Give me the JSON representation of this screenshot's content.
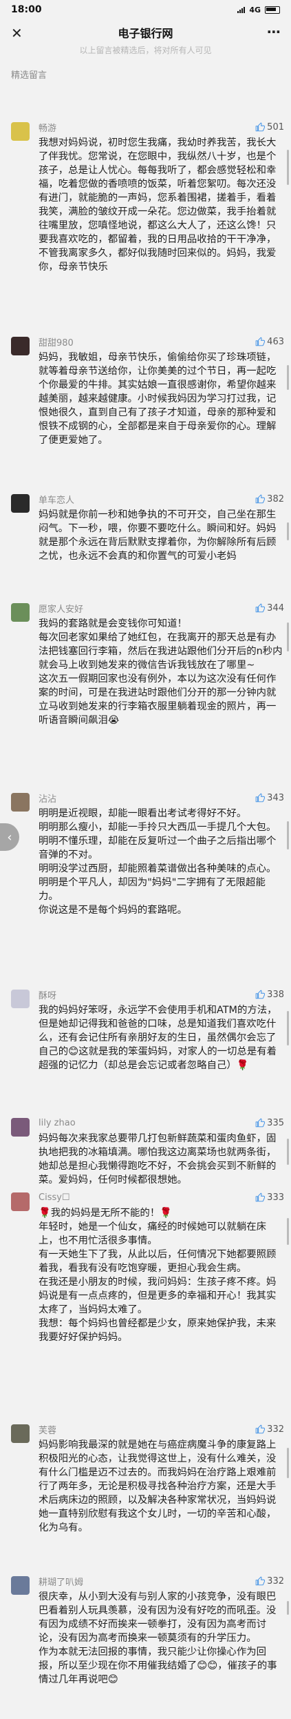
{
  "status": {
    "time": "18:00",
    "network": "4G"
  },
  "nav": {
    "title": "电子银行网",
    "close_icon": "close-icon",
    "more_icon": "more-icon"
  },
  "notice": "以上留言被精选后，将对所有人可见",
  "section_title": "精选留言",
  "comments": [
    {
      "name": "畅游",
      "likes": "501",
      "avatar_color": "#d9c24a",
      "text": "我想对妈妈说，初时您生我痛，我幼时养我苦，我长大了伴我忧。您常说，在您眼中，我纵然八十岁，也是个孩子，总是让人忧心。每每我听了，都会感觉轻松和幸福，吃着您做的香喷喷的饭菜，听着您絮叨。每次还没有进门，就能脆的一声妈，您系着围裙，搓着手，看着我笑，满脸的皱纹开成一朵花。您边做菜，我手抬着就往嘴里放，您嗔怪地说，都这么大人了，还这么馋！只要我喜欢吃的，都留着，我的日用品收拾的干干净净，不管我离家多久，都好似我随时回来似的。妈妈，我爱你，母亲节快乐"
    },
    {
      "name": "甜甜980",
      "likes": "463",
      "avatar_color": "#3a2a2a",
      "text": "妈妈，我敏姐，母亲节快乐，偷偷给你买了珍珠项链，就等着母亲节送给你，让你美美的过个节日，再一起吃个你最爱的牛排。其实姑娘一直很感谢你，希望你越来越美丽，越来越健康。小时候我妈因为学习打过我，记恨她很久，直到自己有了孩子才知道，母亲的那种爱和恨铁不成钢的心，全部都是来自于母亲爱你的心。理解了便更爱她了。"
    },
    {
      "name": "单车恋人",
      "likes": "382",
      "avatar_color": "#2a2a2a",
      "text": "妈妈就是你前一秒和她争执的不可开交，自己坐在那生闷气。下一秒，喂，你要不要吃什么。瞬间和好。妈妈就是那个永远在背后默默支撑着你，为你解除所有后顾之忧，也永远不会真的和你置气的可爱小老妈"
    },
    {
      "name": "愿家人安好",
      "likes": "344",
      "avatar_color": "#6b8f5a",
      "text": "我妈的套路就是会变钱你可知道！\n每次回老家如果给了她红包，在我离开的那天总是有办法把钱塞回行李箱，然后在我进站跟他们分开后的n秒内就会马上收到她发来的微信告诉我钱放在了哪里~\n这次五一假期回家也没有例外，本以为这次没有任何作案的时间，可是在我进站时跟他们分开的那一分钟内就立马收到她发来的行李箱衣服里躺着现金的照片，再一听语音瞬间飙泪😭"
    },
    {
      "name": "沾沾",
      "likes": "343",
      "avatar_color": "#8a7560",
      "text": "明明是近视眼，却能一眼看出考试考得好不好。\n明明那么瘦小，却能一手拎只大西瓜一手提几个大包。\n明明不懂乐理，却能在反复听过一个曲子之后指出哪个音弹的不对。\n明明没学过西厨，却能照着菜谱做出各种美味的点心。\n明明是个平凡人，却因为\"妈妈\"二字拥有了无限超能力。\n你说这是不是每个妈妈的套路呢。"
    },
    {
      "name": "酥呀",
      "likes": "338",
      "avatar_color": "#c8c8d8",
      "text": "我的妈妈好笨呀，永远学不会使用手机和ATM的方法，但是她却记得我和爸爸的口味，总是知道我们喜欢吃什么，还有会记住所有亲朋好友的生日，虽然偶尔会忘了自己的😊这就是我的笨蛋妈妈，对家人的一切总是有着超强的记忆力（却总是会忘记或者忽略自己）🌹"
    },
    {
      "name": "lily zhao",
      "likes": "335",
      "avatar_color": "#7a5a7a",
      "text": "妈妈每次来我家总要带几打包新鲜蔬菜和蛋肉鱼虾，固执地把我的冰箱填满。哪怕我这边离菜场也就两条街，她却总是担心我懒得跑吃不好，不会挑会买到不新鲜的菜。爱妈妈，任何时候都很想她。"
    },
    {
      "name": "Cissy☐",
      "likes": "333",
      "avatar_color": "#b56a6a",
      "text": "🌹我的妈妈是无所不能的！🌹\n年轻时，她是一个仙女，痛经的时候她可以就躺在床上，也不用忙活很多事情。\n有一天她生下了我，从此以后，任何情况下她都要照顾着我，看我有没有吃饱穿暖，更担心我会生病。\n在我还是小朋友的时候，我问妈妈：生孩子疼不疼。妈妈说是有一点点疼的，但是更多的幸福和开心！我其实太疼了，当妈妈太难了。\n我想：每个妈妈也曾经都是少女，原来她保护我，未来我要好好保护妈妈。"
    },
    {
      "name": "芙蓉",
      "likes": "332",
      "avatar_color": "#6a6a5a",
      "text": "妈妈影响我最深的就是她在与癌症病魔斗争的康复路上积极阳光的心态，让我觉得这世上，没有什么难关，没有什么门槛是迈不过去的。而我妈妈在治疗路上艰难前行了两年多，无论是积极寻找各种治疗方案，还是大手术后病床边的照顾，以及解决各种家常状况，当妈妈说她一直特别欣慰有我这个女儿时，一切的辛苦和心酸，化为乌有。"
    },
    {
      "name": "耕瑚了叭姆",
      "likes": "332",
      "avatar_color": "#6a7a9a",
      "text": "很庆幸，从小到大没有与别人家的小孩竞争，没有眼巴巴看着别人玩具羡慕，没有因为没有好吃的而吼歪。没有因为成绩不好而挨来一顿拳打，没有因为高考而讨论，没有因为高考而换来一顿莫须有的升学压力。\n作为本就无法回报的事情，我只能少让你操心作为回报，所以至少现在你不用催我结婚了😊😊，催孩子的事情过几年再说吧😊"
    }
  ]
}
